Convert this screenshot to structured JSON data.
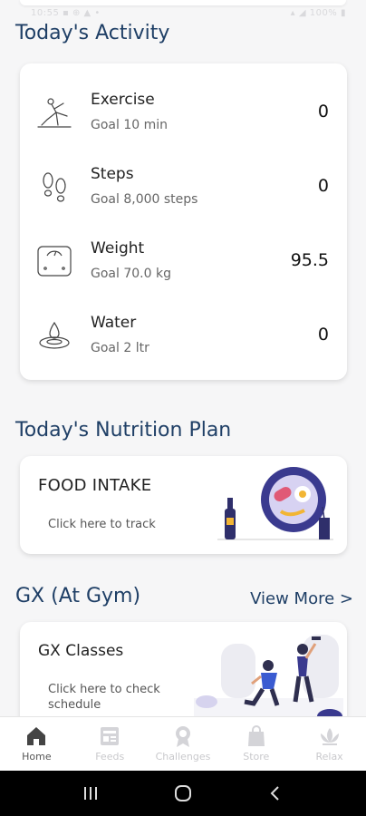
{
  "status_bar": {
    "left": "10:55 ▪ ⊕ ▲ •",
    "right": "▴ ◢ 100% ▮"
  },
  "activity": {
    "title": "Today's Activity",
    "items": [
      {
        "name": "Exercise",
        "goal": "Goal 10 min",
        "value": "0",
        "icon": "exercise-icon"
      },
      {
        "name": "Steps",
        "goal": "Goal 8,000 steps",
        "value": "0",
        "icon": "footsteps-icon"
      },
      {
        "name": "Weight",
        "goal": "Goal 70.0 kg",
        "value": "95.5",
        "icon": "scale-icon"
      },
      {
        "name": "Water",
        "goal": "Goal 2 ltr",
        "value": "0",
        "icon": "water-drop-icon"
      }
    ]
  },
  "nutrition": {
    "title": "Today's Nutrition Plan",
    "card_title": "FOOD INTAKE",
    "card_sub": "Click here to track"
  },
  "gx": {
    "title": "GX (At Gym)",
    "view_more": "View More >",
    "card_title": "GX Classes",
    "card_sub": "Click here to check schedule"
  },
  "nav": {
    "items": [
      {
        "label": "Home",
        "icon": "home-icon",
        "active": true
      },
      {
        "label": "Feeds",
        "icon": "feeds-icon",
        "active": false
      },
      {
        "label": "Challenges",
        "icon": "award-icon",
        "active": false
      },
      {
        "label": "Store",
        "icon": "shopping-bag-icon",
        "active": false
      },
      {
        "label": "Relax",
        "icon": "lotus-icon",
        "active": false
      }
    ]
  },
  "colors": {
    "title_blue": "#1f3f66",
    "accent_purple": "#3a3a8f",
    "accent_yellow": "#f2b534"
  }
}
